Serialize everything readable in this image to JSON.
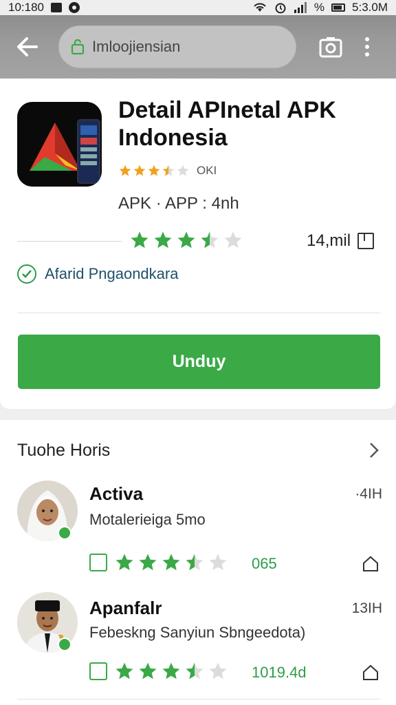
{
  "status_bar": {
    "time_left": "10:180",
    "battery_pct": "%",
    "time_right": "5:3.0M"
  },
  "toolbar": {
    "search_value": "Imloojiensian",
    "search_placeholder": "Imloojiensian",
    "icons": {
      "back": "back-arrow-icon",
      "lock": "lock-icon",
      "camera": "camera-icon",
      "more": "more-vert-icon"
    }
  },
  "app": {
    "title": "Detail APInetal APK Indonesia",
    "rating_text": "OKI",
    "rating_small_stars": 3.5,
    "meta": "APK · APP : 4nh",
    "rating_stars": 3.5,
    "downloads": "14,mil",
    "verified_text": "Afarid Pngaondkara",
    "install_label": "Unduy"
  },
  "reviews": {
    "header": "Tuohe Horis",
    "items": [
      {
        "name": "Activa",
        "time": "·4IH",
        "description": "Motalerieiga 5mo",
        "stars": 3.5,
        "count": "065"
      },
      {
        "name": "Apanfalr",
        "time": "13IH",
        "description": "Febeskng Sanyiun Sbngeedota)",
        "stars": 3.5,
        "count": "1019.4d"
      }
    ]
  },
  "colors": {
    "accent_green": "#3aa946",
    "star_gold": "#f0a21f",
    "toolbar_gray": "#9a9a9a"
  }
}
